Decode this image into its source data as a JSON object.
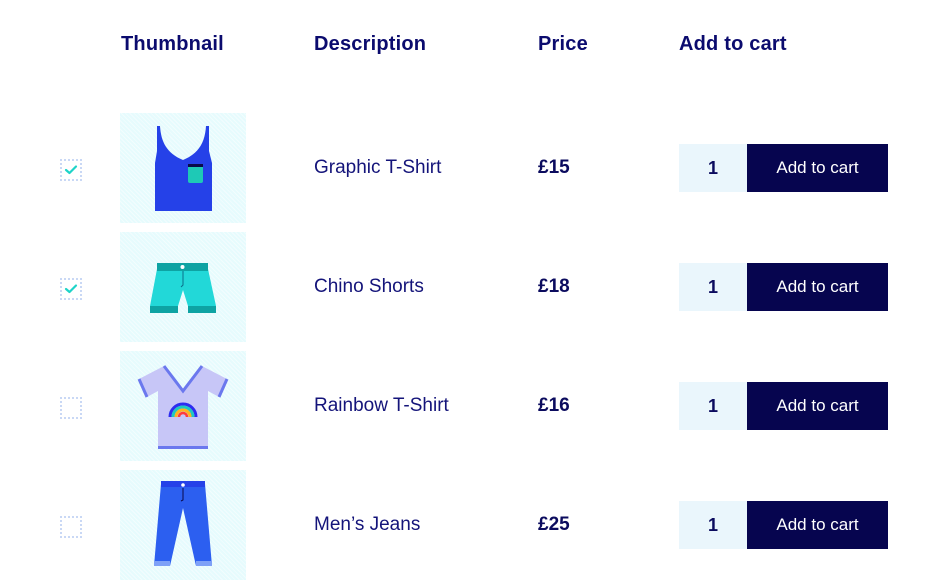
{
  "headers": {
    "thumbnail": "Thumbnail",
    "description": "Description",
    "price": "Price",
    "add_to_cart": "Add to cart"
  },
  "products": [
    {
      "checked": true,
      "thumbnail_icon": "tank-top-icon",
      "description": "Graphic T-Shirt",
      "price": "£15",
      "quantity": "1",
      "button_label": "Add to cart"
    },
    {
      "checked": true,
      "thumbnail_icon": "shorts-icon",
      "description": "Chino Shorts",
      "price": "£18",
      "quantity": "1",
      "button_label": "Add to cart"
    },
    {
      "checked": false,
      "thumbnail_icon": "rainbow-tshirt-icon",
      "description": "Rainbow T-Shirt",
      "price": "£16",
      "quantity": "1",
      "button_label": "Add to cart"
    },
    {
      "checked": false,
      "thumbnail_icon": "jeans-icon",
      "description": "Men’s Jeans",
      "price": "£25",
      "quantity": "1",
      "button_label": "Add to cart"
    }
  ],
  "colors": {
    "primary": "#06054f",
    "text": "#14147a",
    "check": "#1ed4c8",
    "thumb_bg": "#e6fbfd"
  }
}
